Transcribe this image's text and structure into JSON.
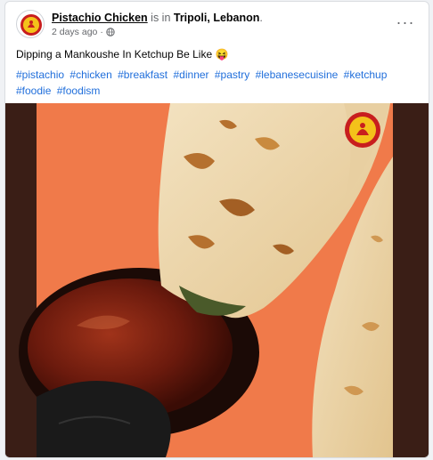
{
  "post": {
    "page_name": "Pistachio Chicken",
    "is_in_text": " is in ",
    "location": "Tripoli, Lebanon",
    "location_suffix": ".",
    "time": "2 days ago",
    "time_separator": "·",
    "caption": "Dipping a Mankoushe In Ketchup Be Like 😝",
    "hashtags": [
      "#pistachio",
      "#chicken",
      "#breakfast",
      "#dinner",
      "#pastry",
      "#lebanesecuisine",
      "#ketchup",
      "#foodie",
      "#foodism"
    ],
    "more_label": "···"
  },
  "icons": {
    "avatar": "pistachio-chicken-logo",
    "audience": "globe-icon",
    "more": "more-options-icon",
    "watermark": "pistachio-chicken-logo"
  },
  "colors": {
    "link": "#216fdb",
    "brand_red": "#c81e1e",
    "brand_yellow": "#f4c21a",
    "photo_background": "#f07a4a"
  }
}
